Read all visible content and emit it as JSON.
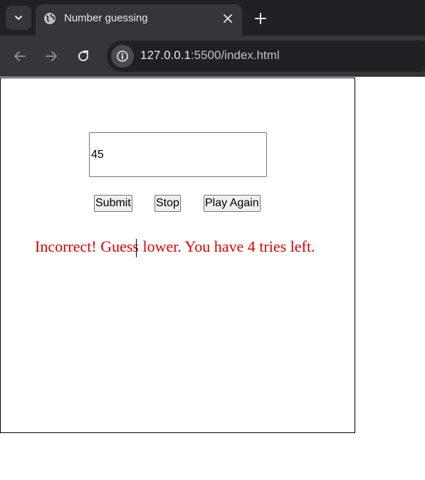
{
  "browser": {
    "tab": {
      "title": "Number guessing"
    },
    "address_bar": {
      "host": "127.0.0.1",
      "path": ":5500/index.html"
    }
  },
  "page": {
    "guess_input": {
      "value": "45"
    },
    "buttons": {
      "submit": "Submit",
      "stop": "Stop",
      "play_again": "Play Again"
    },
    "message": "Incorrect! Guess lower. You have 4 tries left.",
    "message_color": "#e00000"
  }
}
